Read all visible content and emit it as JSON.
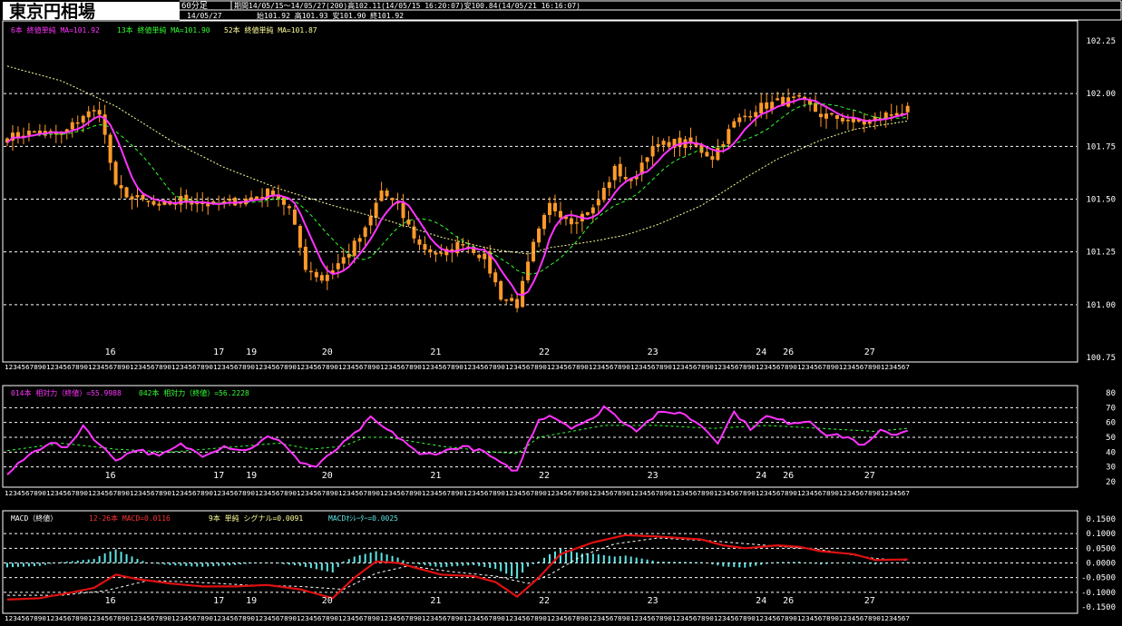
{
  "header": {
    "title": "東京円相場",
    "timeframe": "60分足",
    "period_line": "期間14/05/15～14/05/27(200)高102.11(14/05/15 16:20:07)安100.84(14/05/21 16:16:07)",
    "date_line": "14/05/27",
    "ohlc_line": "始101.92  高101.93  安101.90  終101.92"
  },
  "legends": {
    "ma_short": "6本 終値単純 MA=101.92",
    "ma_mid": "13本 終値単純 MA=101.90",
    "ma_long": "52本 終値単純 MA=101.87",
    "rsi_short": "014本 相対力（終値）=55.9988",
    "rsi_long": "042本 相対力（終値）=56.2228",
    "macd_name": "MACD（終値）",
    "macd_val": "12-26本 MACD=0.0116",
    "signal_val": "9本 単純 シグナル=0.0091",
    "osc_val": "MACDｵｼﾚｰﾀｰ=0.0025"
  },
  "colors": {
    "background": "#000000",
    "grid": "#ffffff",
    "candle": "#ff9a2a",
    "ma_short": "#ff33ff",
    "ma_mid": "#33ff33",
    "ma_long": "#ffff99",
    "rsi_long": "#33ff33",
    "macd": "#e01010",
    "signal": "#ffffff",
    "osc": "#5ee6e6",
    "title_bg": "#ffffff",
    "title_text": "#000000"
  },
  "hour_strip": "1234567890123456789012345678901234567890123456789012345678901234567890123456789012345678901234567890123456789012345678901234567890123456789012345678901234567890123456789012345678901234567890123456789012345678901234567",
  "chart_data": [
    {
      "type": "candlestick",
      "title": "東京円相場",
      "ylim": [
        100.75,
        102.25
      ],
      "y_ticks": [
        "102.25",
        "102.00",
        "101.75",
        "101.50",
        "101.25",
        "101.00",
        "100.75"
      ],
      "day_labels": [
        {
          "label": "16",
          "index": 19
        },
        {
          "label": "17",
          "index": 39
        },
        {
          "label": "19",
          "index": 45
        },
        {
          "label": "20",
          "index": 59
        },
        {
          "label": "21",
          "index": 79
        },
        {
          "label": "22",
          "index": 99
        },
        {
          "label": "23",
          "index": 119
        },
        {
          "label": "24",
          "index": 139
        },
        {
          "label": "26",
          "index": 144
        },
        {
          "label": "27",
          "index": 159
        }
      ],
      "close_anchors": [
        [
          0,
          101.79
        ],
        [
          5,
          101.82
        ],
        [
          10,
          101.8
        ],
        [
          14,
          101.9
        ],
        [
          17,
          101.92
        ],
        [
          20,
          101.55
        ],
        [
          24,
          101.5
        ],
        [
          28,
          101.46
        ],
        [
          32,
          101.5
        ],
        [
          38,
          101.47
        ],
        [
          44,
          101.5
        ],
        [
          49,
          101.54
        ],
        [
          52,
          101.45
        ],
        [
          55,
          101.18
        ],
        [
          58,
          101.12
        ],
        [
          62,
          101.22
        ],
        [
          66,
          101.35
        ],
        [
          69,
          101.54
        ],
        [
          72,
          101.46
        ],
        [
          76,
          101.28
        ],
        [
          80,
          101.23
        ],
        [
          84,
          101.3
        ],
        [
          88,
          101.22
        ],
        [
          91,
          101.04
        ],
        [
          94,
          101.0
        ],
        [
          97,
          101.28
        ],
        [
          100,
          101.47
        ],
        [
          104,
          101.4
        ],
        [
          108,
          101.45
        ],
        [
          112,
          101.64
        ],
        [
          115,
          101.58
        ],
        [
          118,
          101.72
        ],
        [
          122,
          101.77
        ],
        [
          126,
          101.76
        ],
        [
          130,
          101.7
        ],
        [
          134,
          101.86
        ],
        [
          138,
          101.93
        ],
        [
          142,
          101.96
        ],
        [
          146,
          101.97
        ],
        [
          150,
          101.9
        ],
        [
          154,
          101.88
        ],
        [
          158,
          101.86
        ],
        [
          162,
          101.9
        ],
        [
          166,
          101.92
        ]
      ],
      "ma_long_anchors": [
        [
          0,
          102.13
        ],
        [
          10,
          102.06
        ],
        [
          20,
          101.94
        ],
        [
          30,
          101.78
        ],
        [
          40,
          101.65
        ],
        [
          50,
          101.55
        ],
        [
          60,
          101.47
        ],
        [
          70,
          101.4
        ],
        [
          80,
          101.32
        ],
        [
          90,
          101.26
        ],
        [
          96,
          101.24
        ],
        [
          100,
          101.27
        ],
        [
          108,
          101.3
        ],
        [
          114,
          101.33
        ],
        [
          120,
          101.38
        ],
        [
          128,
          101.47
        ],
        [
          136,
          101.6
        ],
        [
          142,
          101.69
        ],
        [
          150,
          101.78
        ],
        [
          156,
          101.83
        ],
        [
          166,
          101.87
        ]
      ]
    },
    {
      "type": "line",
      "title": "RSI",
      "ylim": [
        20,
        80
      ],
      "y_ticks": [
        "80",
        "70",
        "60",
        "50",
        "40",
        "30",
        "20"
      ],
      "rsi_short_anchors": [
        [
          0,
          25
        ],
        [
          4,
          38
        ],
        [
          8,
          47
        ],
        [
          11,
          42
        ],
        [
          14,
          58
        ],
        [
          17,
          45
        ],
        [
          20,
          35
        ],
        [
          24,
          42
        ],
        [
          28,
          37
        ],
        [
          32,
          45
        ],
        [
          36,
          38
        ],
        [
          40,
          44
        ],
        [
          44,
          41
        ],
        [
          48,
          50
        ],
        [
          51,
          46
        ],
        [
          54,
          33
        ],
        [
          57,
          30
        ],
        [
          60,
          40
        ],
        [
          64,
          52
        ],
        [
          67,
          63
        ],
        [
          70,
          55
        ],
        [
          73,
          48
        ],
        [
          76,
          38
        ],
        [
          80,
          40
        ],
        [
          84,
          44
        ],
        [
          88,
          40
        ],
        [
          91,
          32
        ],
        [
          94,
          27
        ],
        [
          96,
          46
        ],
        [
          98,
          62
        ],
        [
          100,
          65
        ],
        [
          104,
          57
        ],
        [
          108,
          62
        ],
        [
          110,
          71
        ],
        [
          113,
          62
        ],
        [
          116,
          55
        ],
        [
          120,
          66
        ],
        [
          124,
          67
        ],
        [
          128,
          58
        ],
        [
          131,
          47
        ],
        [
          134,
          67
        ],
        [
          137,
          56
        ],
        [
          140,
          64
        ],
        [
          144,
          60
        ],
        [
          148,
          61
        ],
        [
          151,
          52
        ],
        [
          155,
          50
        ],
        [
          158,
          44
        ],
        [
          161,
          54
        ],
        [
          164,
          52
        ],
        [
          166,
          55
        ]
      ],
      "rsi_long_anchors": [
        [
          0,
          41
        ],
        [
          10,
          46
        ],
        [
          20,
          42
        ],
        [
          30,
          40
        ],
        [
          40,
          43
        ],
        [
          50,
          46
        ],
        [
          56,
          42
        ],
        [
          62,
          44
        ],
        [
          66,
          50
        ],
        [
          70,
          50
        ],
        [
          80,
          44
        ],
        [
          90,
          40
        ],
        [
          94,
          39
        ],
        [
          98,
          50
        ],
        [
          104,
          54
        ],
        [
          110,
          58
        ],
        [
          120,
          58
        ],
        [
          130,
          56
        ],
        [
          140,
          58
        ],
        [
          150,
          56
        ],
        [
          160,
          54
        ],
        [
          166,
          56
        ]
      ]
    },
    {
      "type": "line",
      "title": "MACD（終値）",
      "ylim": [
        -0.15,
        0.15
      ],
      "y_ticks": [
        "0.1500",
        "0.1000",
        "0.0500",
        "0.0000",
        "-0.0500",
        "-0.1000",
        "-0.1500"
      ],
      "macd_anchors": [
        [
          0,
          -0.125
        ],
        [
          6,
          -0.12
        ],
        [
          12,
          -0.1
        ],
        [
          16,
          -0.085
        ],
        [
          20,
          -0.04
        ],
        [
          24,
          -0.055
        ],
        [
          30,
          -0.07
        ],
        [
          36,
          -0.08
        ],
        [
          42,
          -0.08
        ],
        [
          48,
          -0.075
        ],
        [
          54,
          -0.09
        ],
        [
          60,
          -0.12
        ],
        [
          64,
          -0.05
        ],
        [
          68,
          0.005
        ],
        [
          72,
          0.0
        ],
        [
          76,
          -0.02
        ],
        [
          80,
          -0.04
        ],
        [
          86,
          -0.045
        ],
        [
          90,
          -0.065
        ],
        [
          94,
          -0.115
        ],
        [
          98,
          -0.05
        ],
        [
          102,
          0.03
        ],
        [
          108,
          0.07
        ],
        [
          114,
          0.095
        ],
        [
          120,
          0.09
        ],
        [
          128,
          0.08
        ],
        [
          132,
          0.06
        ],
        [
          136,
          0.05
        ],
        [
          142,
          0.06
        ],
        [
          146,
          0.055
        ],
        [
          150,
          0.04
        ],
        [
          156,
          0.03
        ],
        [
          160,
          0.01
        ],
        [
          166,
          0.012
        ]
      ],
      "signal_anchors": [
        [
          0,
          -0.11
        ],
        [
          10,
          -0.11
        ],
        [
          18,
          -0.095
        ],
        [
          26,
          -0.06
        ],
        [
          34,
          -0.065
        ],
        [
          44,
          -0.075
        ],
        [
          54,
          -0.08
        ],
        [
          62,
          -0.09
        ],
        [
          68,
          -0.035
        ],
        [
          74,
          -0.01
        ],
        [
          82,
          -0.03
        ],
        [
          90,
          -0.045
        ],
        [
          96,
          -0.07
        ],
        [
          100,
          -0.04
        ],
        [
          106,
          0.025
        ],
        [
          112,
          0.065
        ],
        [
          120,
          0.085
        ],
        [
          130,
          0.075
        ],
        [
          140,
          0.06
        ],
        [
          150,
          0.045
        ],
        [
          160,
          0.015
        ],
        [
          166,
          0.009
        ]
      ]
    }
  ]
}
